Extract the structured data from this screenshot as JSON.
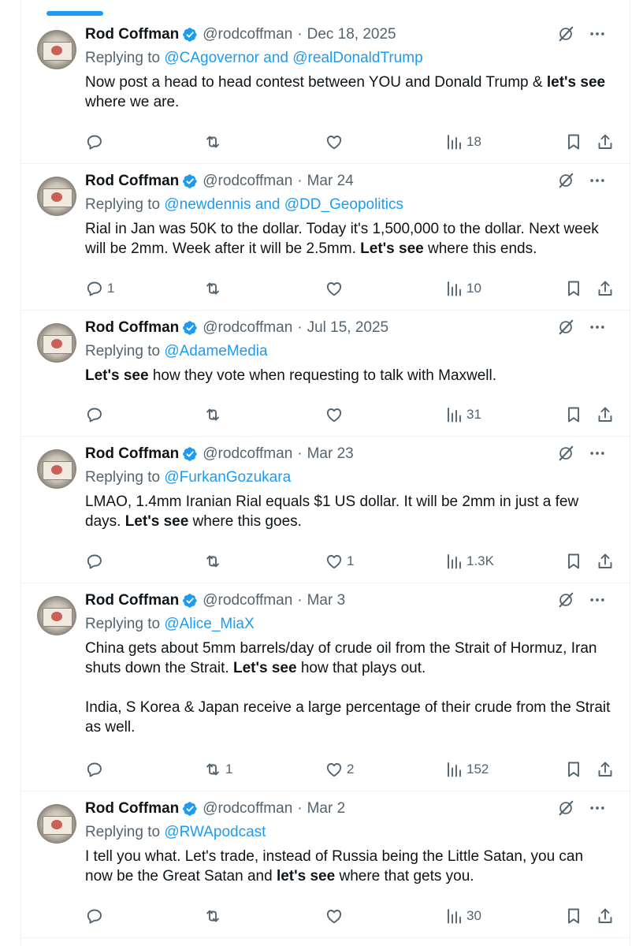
{
  "timeline": {
    "tweets": [
      {
        "name": "Rod Coffman",
        "handle": "@rodcoffman",
        "date": "Dec 18, 2025",
        "replying_prefix": "Replying to ",
        "replying_to": "@CAgovernor and @realDonaldTrump",
        "paragraphs": [
          [
            {
              "t": "Now post a head to head contest between YOU and Donald Trump & ",
              "b": false
            },
            {
              "t": "let's see",
              "b": true
            },
            {
              "t": " where we are.",
              "b": false
            }
          ]
        ],
        "replies": "",
        "retweets": "",
        "likes": "",
        "views": "18"
      },
      {
        "name": "Rod Coffman",
        "handle": "@rodcoffman",
        "date": "Mar 24",
        "replying_prefix": "Replying to ",
        "replying_to": "@newdennis and @DD_Geopolitics",
        "paragraphs": [
          [
            {
              "t": "Rial in Jan was 50K to the dollar. Today it's 1,500,000 to the dollar. Next week will be 2mm. Week after it  will be 2.5mm. ",
              "b": false
            },
            {
              "t": "Let's see",
              "b": true
            },
            {
              "t": " where this ends.",
              "b": false
            }
          ]
        ],
        "replies": "1",
        "retweets": "",
        "likes": "",
        "views": "10"
      },
      {
        "name": "Rod Coffman",
        "handle": "@rodcoffman",
        "date": "Jul 15, 2025",
        "replying_prefix": "Replying to ",
        "replying_to": "@AdameMedia",
        "paragraphs": [
          [
            {
              "t": "Let's see",
              "b": true
            },
            {
              "t": " how they vote when requesting to talk with Maxwell.",
              "b": false
            }
          ]
        ],
        "replies": "",
        "retweets": "",
        "likes": "",
        "views": "31"
      },
      {
        "name": "Rod Coffman",
        "handle": "@rodcoffman",
        "date": "Mar 23",
        "replying_prefix": "Replying to ",
        "replying_to": "@FurkanGozukara",
        "paragraphs": [
          [
            {
              "t": "LMAO, 1.4mm Iranian Rial equals $1 US dollar. It will be 2mm in just a few days. ",
              "b": false
            },
            {
              "t": "Let's see",
              "b": true
            },
            {
              "t": " where this goes.",
              "b": false
            }
          ]
        ],
        "replies": "",
        "retweets": "",
        "likes": "1",
        "views": "1.3K"
      },
      {
        "name": "Rod Coffman",
        "handle": "@rodcoffman",
        "date": "Mar 3",
        "replying_prefix": "Replying to ",
        "replying_to": "@Alice_MiaX",
        "paragraphs": [
          [
            {
              "t": "China gets about 5mm barrels/day of crude oil from the Strait of Hormuz, Iran shuts down the Strait. ",
              "b": false
            },
            {
              "t": "Let's see",
              "b": true
            },
            {
              "t": " how that plays out.",
              "b": false
            }
          ],
          [
            {
              "t": "India, S Korea & Japan receive a large percentage of their crude from the Strait as well.",
              "b": false
            }
          ]
        ],
        "replies": "",
        "retweets": "1",
        "likes": "2",
        "views": "152"
      },
      {
        "name": "Rod Coffman",
        "handle": "@rodcoffman",
        "date": "Mar 2",
        "replying_prefix": "Replying to ",
        "replying_to": "@RWApodcast",
        "paragraphs": [
          [
            {
              "t": "I tell you what. Let's trade, instead of Russia being the Little Satan, you can now be the Great Satan and ",
              "b": false
            },
            {
              "t": "let's see",
              "b": true
            },
            {
              "t": " where that gets you.",
              "b": false
            }
          ]
        ],
        "replies": "",
        "retweets": "",
        "likes": "",
        "views": "30"
      }
    ]
  },
  "colors": {
    "accent": "#1d9bf0",
    "text": "#0f1419",
    "muted": "#536471",
    "divider": "#eff3f4"
  },
  "icons": [
    "verified-badge-icon",
    "grok-icon",
    "more-icon",
    "reply-icon",
    "retweet-icon",
    "like-icon",
    "views-icon",
    "bookmark-icon",
    "share-icon"
  ]
}
